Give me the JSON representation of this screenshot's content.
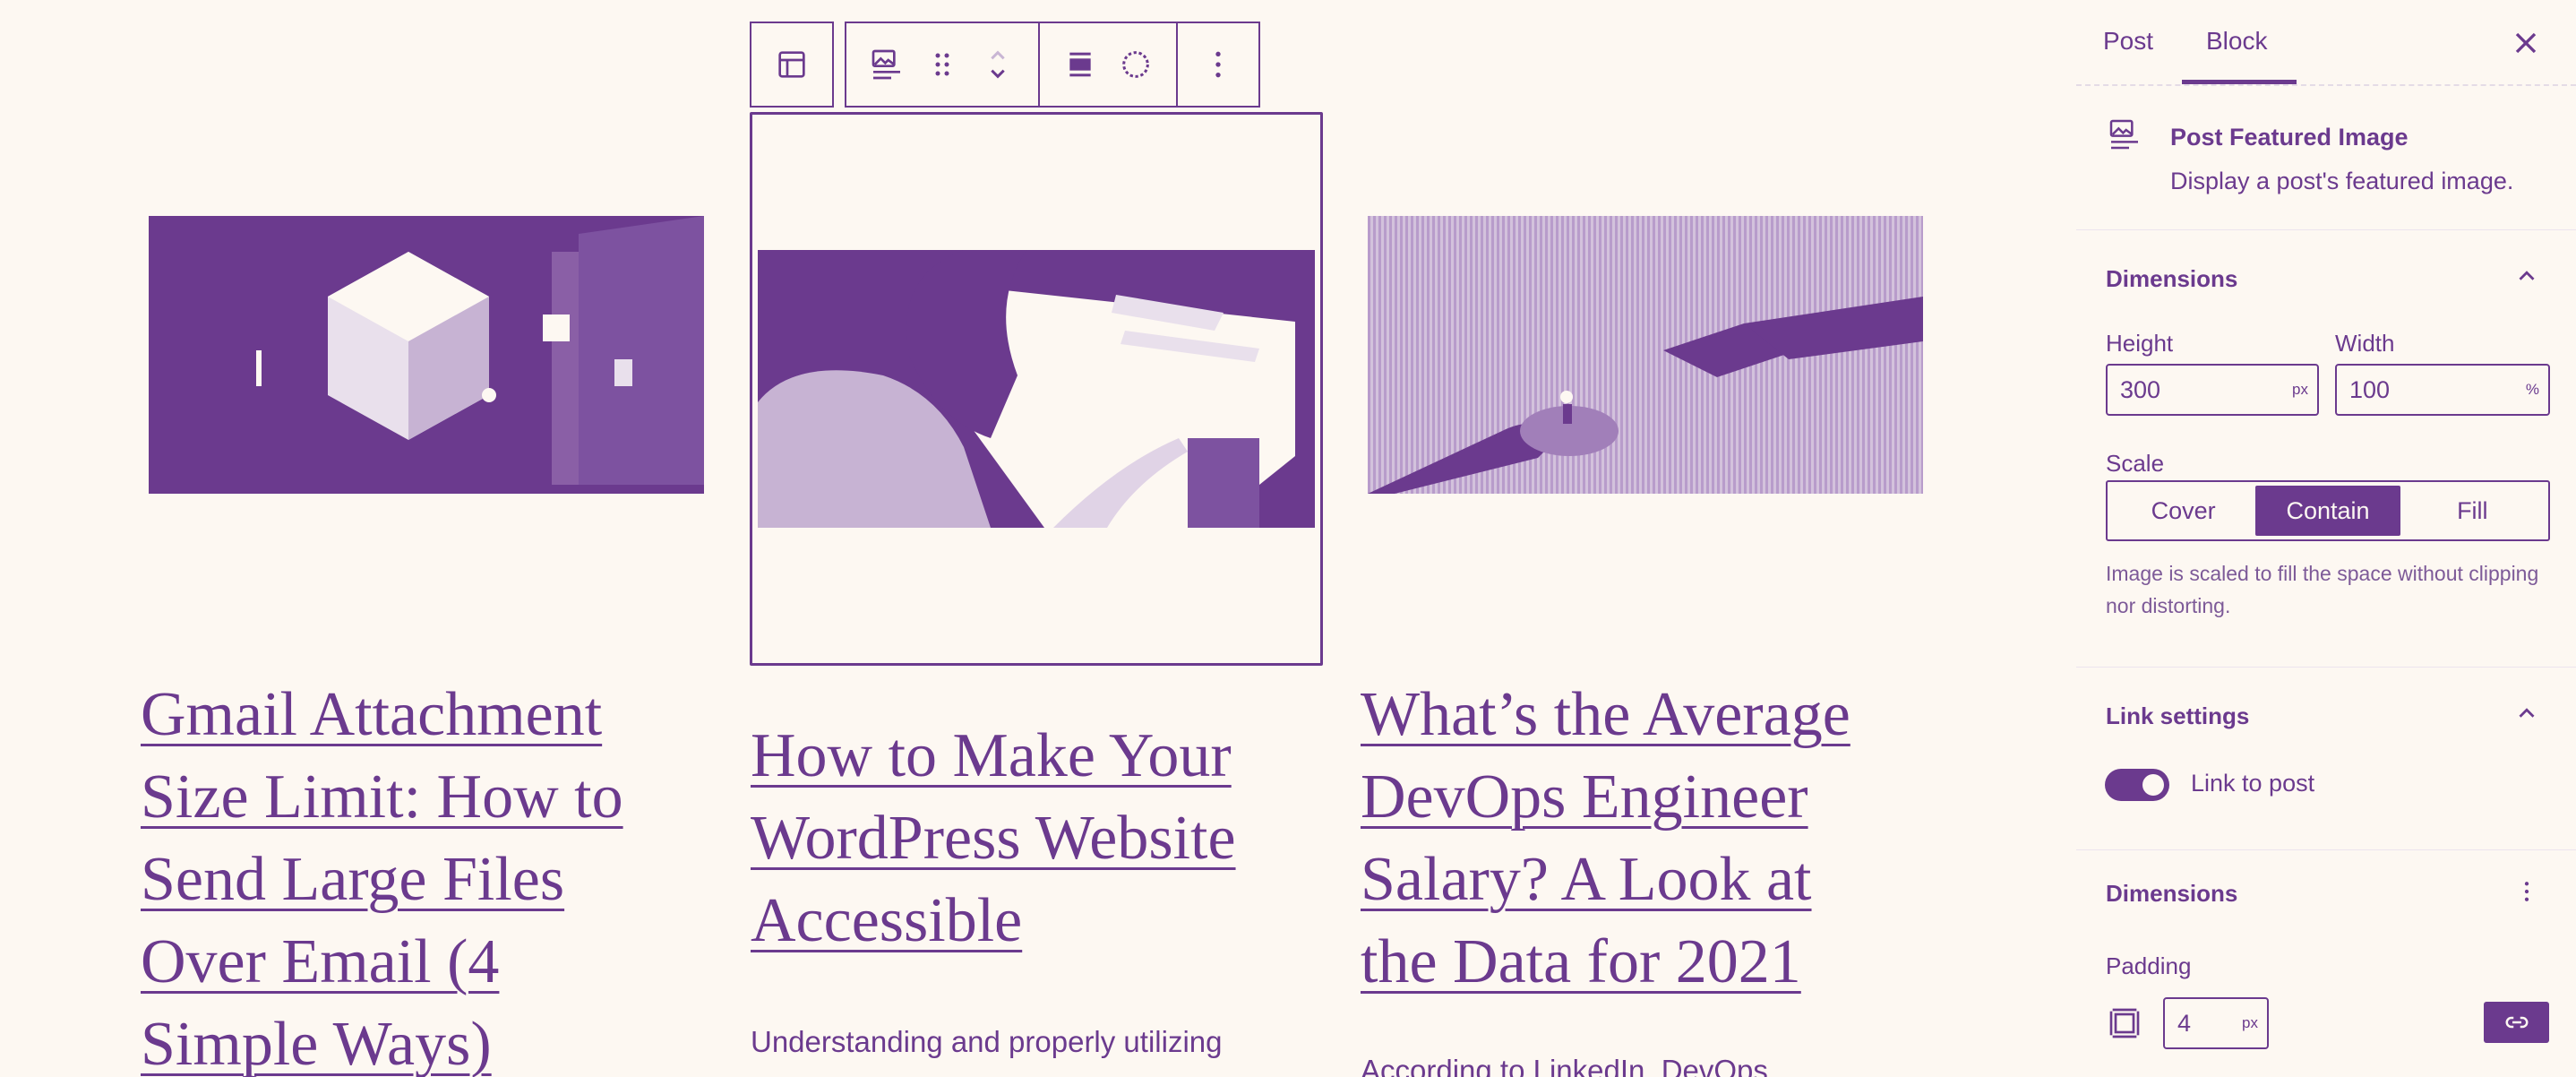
{
  "posts": [
    {
      "title": "Gmail Attachment Size Limit: How to Send Large Files Over Email (4 Simple Ways)",
      "title_lines": [
        "Gmail Attachment",
        "Size Limit: How to",
        "Send Large Files",
        "Over Email (4",
        "Simple Ways)"
      ],
      "excerpt": ""
    },
    {
      "title": "How to Make Your WordPress Website Accessible",
      "title_lines": [
        "How to Make Your",
        "WordPress Website",
        "Accessible"
      ],
      "excerpt": "Understanding and properly utilizing"
    },
    {
      "title": "What’s the Average DevOps Engineer Salary? A Look at the Data for 2021",
      "title_lines": [
        "What’s the Average",
        "DevOps Engineer",
        "Salary? A Look at",
        "the Data for 2021"
      ],
      "excerpt": "According to LinkedIn, DevOps"
    }
  ],
  "toolbar": {
    "icons": [
      "layout-parent-icon",
      "featured-image-icon",
      "drag-handle-icon",
      "move-up-down-icon",
      "align-icon",
      "duotone-icon",
      "more-options-icon"
    ]
  },
  "sidebar": {
    "tabs": [
      {
        "label": "Post",
        "active": false
      },
      {
        "label": "Block",
        "active": true
      }
    ],
    "block_card": {
      "title": "Post Featured Image",
      "description": "Display a post's featured image."
    },
    "dimensions_panel": {
      "title": "Dimensions",
      "height_label": "Height",
      "height_value": "300",
      "height_unit": "px",
      "width_label": "Width",
      "width_value": "100",
      "width_unit": "%",
      "scale_label": "Scale",
      "scale_options": [
        "Cover",
        "Contain",
        "Fill"
      ],
      "scale_selected": "Contain",
      "scale_help": "Image is scaled to fill the space without clipping nor distorting."
    },
    "link_panel": {
      "title": "Link settings",
      "toggle_label": "Link to post",
      "toggle_on": true
    },
    "styles_dimensions_panel": {
      "title": "Dimensions",
      "padding_label": "Padding",
      "padding_value": "4",
      "padding_unit": "px"
    }
  },
  "colors": {
    "background": "#fdf8f2",
    "accent": "#6b3a8e"
  }
}
